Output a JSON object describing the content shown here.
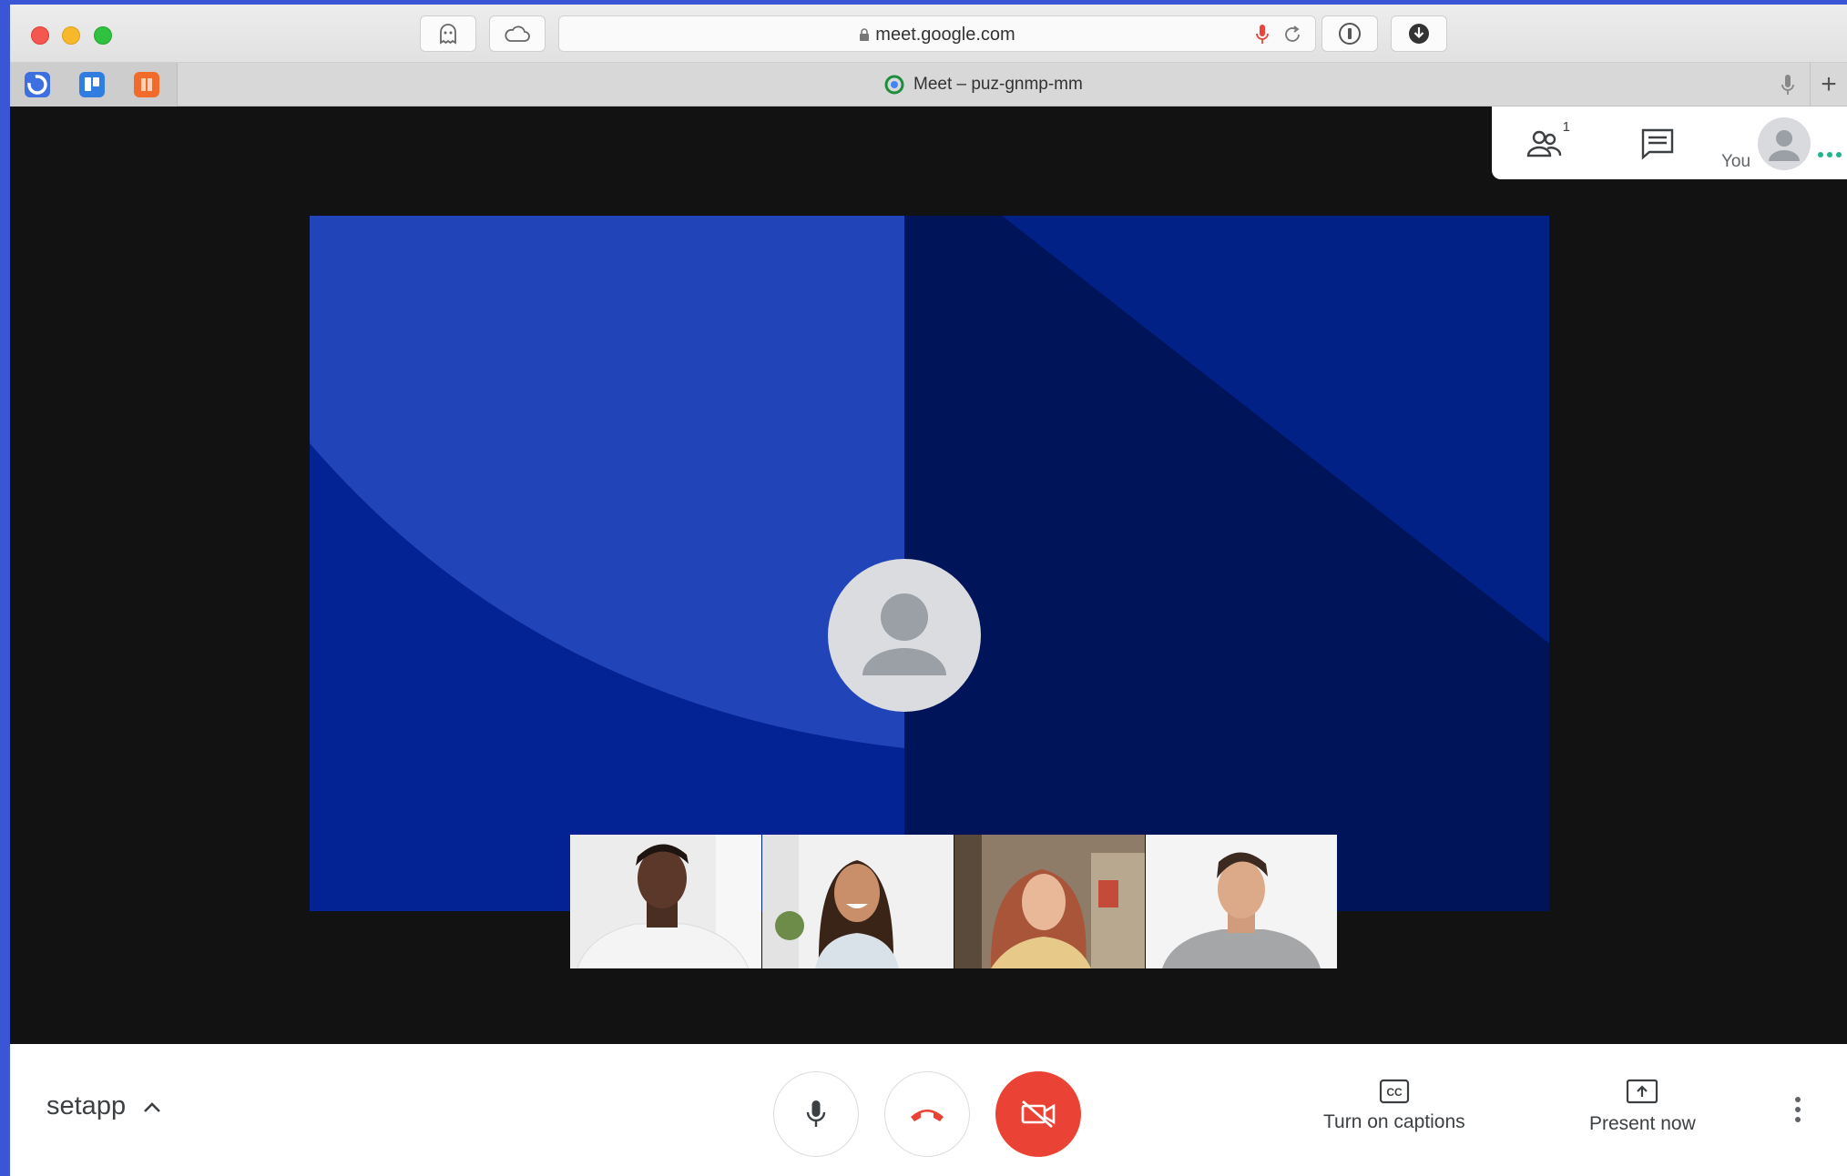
{
  "browser": {
    "url": "meet.google.com",
    "tab_title": "Meet – puz-gnmp-mm"
  },
  "top_panel": {
    "participants_count": "1",
    "self_label": "You"
  },
  "meeting": {
    "name": "setapp"
  },
  "controls": {
    "captions_label": "Turn on captions",
    "present_label": "Present now"
  },
  "colors": {
    "end_call": "#ea4335",
    "accent_blue": "#1a73e8",
    "bg_light_blue": "#2144b8",
    "bg_dark_blue": "#00145a",
    "speaking_dots": "#20b48d"
  }
}
